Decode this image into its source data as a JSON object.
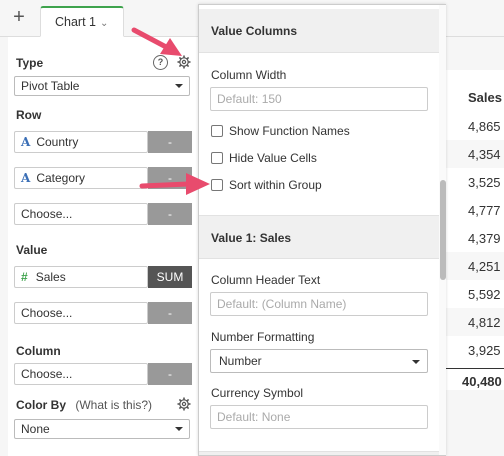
{
  "tabs": {
    "add_label": "+",
    "chart_tab_label": "Chart 1"
  },
  "left_panel": {
    "type_label": "Type",
    "type_value": "Pivot Table",
    "row_label": "Row",
    "row_items": [
      {
        "label": "Country",
        "type_icon": "A",
        "remove": "-"
      },
      {
        "label": "Category",
        "type_icon": "A",
        "remove": "-"
      }
    ],
    "row_choose": {
      "label": "Choose...",
      "remove": "-"
    },
    "value_label": "Value",
    "value_item": {
      "label": "Sales",
      "type_icon": "#",
      "agg": "SUM"
    },
    "value_choose": {
      "label": "Choose...",
      "remove": "-"
    },
    "column_label": "Column",
    "column_choose": {
      "label": "Choose...",
      "remove": "-"
    },
    "color_by_label": "Color By",
    "color_by_help": "(What is this?)",
    "color_by_value": "None",
    "help_icon_label": "?"
  },
  "settings_panel": {
    "section1_title": "Value Columns",
    "column_width_label": "Column Width",
    "column_width_placeholder": "Default: 150",
    "show_function_names": "Show Function Names",
    "hide_value_cells": "Hide Value Cells",
    "sort_within_group": "Sort within Group",
    "section2_title": "Value 1: Sales",
    "column_header_label": "Column Header Text",
    "column_header_placeholder": "Default: (Column Name)",
    "number_formatting_label": "Number Formatting",
    "number_formatting_value": "Number",
    "currency_symbol_label": "Currency Symbol",
    "currency_symbol_placeholder": "Default: None"
  },
  "table": {
    "header": "Sales",
    "values": [
      "4,865",
      "4,354",
      "3,525",
      "4,777",
      "4,379",
      "4,251",
      "5,592",
      "4,812",
      "3,925"
    ],
    "total": "40,480"
  },
  "colors": {
    "accent_green": "#3fa34d",
    "arrow_pink": "#e84b6d"
  }
}
